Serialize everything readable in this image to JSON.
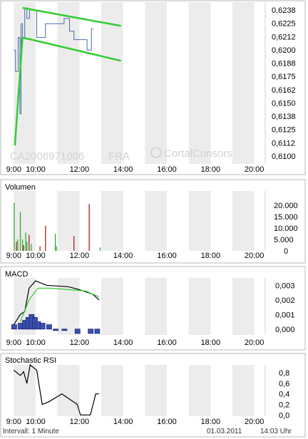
{
  "chart_data": [
    {
      "type": "line",
      "panel": "price",
      "isin_label": "CA2006971006",
      "exchange_label": "FRA",
      "watermark": "CortalConsors",
      "x_tick_labels": [
        "9:00",
        "10:00",
        "12:00",
        "14:00",
        "16:00",
        "18:00",
        "20:00"
      ],
      "y_tick_labels": [
        "0,6238",
        "0,6225",
        "0,6212",
        "0,6200",
        "0,6188",
        "0,6175",
        "0,6162",
        "0,6150",
        "0,6138",
        "0,6125",
        "0,6112",
        "0,6100"
      ],
      "ylim": [
        0.61,
        0.6238
      ],
      "series": [
        {
          "values_time_price": [
            [
              9.0,
              0.62
            ],
            [
              9.08,
              0.62
            ],
            [
              9.08,
              0.618
            ],
            [
              9.2,
              0.618
            ],
            [
              9.2,
              0.6212
            ],
            [
              9.28,
              0.6212
            ],
            [
              9.28,
              0.614
            ],
            [
              9.33,
              0.614
            ],
            [
              9.33,
              0.6225
            ],
            [
              9.4,
              0.6225
            ],
            [
              9.4,
              0.6212
            ],
            [
              9.5,
              0.6212
            ],
            [
              9.5,
              0.624
            ],
            [
              9.6,
              0.624
            ],
            [
              9.6,
              0.623
            ],
            [
              9.72,
              0.623
            ],
            [
              9.72,
              0.6238
            ],
            [
              10.05,
              0.6238
            ],
            [
              10.05,
              0.6212
            ],
            [
              10.45,
              0.6212
            ],
            [
              10.45,
              0.6225
            ],
            [
              11.3,
              0.6225
            ],
            [
              11.3,
              0.623
            ],
            [
              11.55,
              0.623
            ],
            [
              11.55,
              0.6218
            ],
            [
              11.75,
              0.6218
            ],
            [
              11.75,
              0.621
            ],
            [
              12.35,
              0.621
            ],
            [
              12.35,
              0.62
            ],
            [
              12.55,
              0.62
            ],
            [
              12.55,
              0.622
            ],
            [
              12.65,
              0.622
            ]
          ]
        }
      ],
      "trendlines": [
        {
          "from": [
            9.05,
            0.611
          ],
          "to": [
            9.4,
            0.6212
          ]
        },
        {
          "from": [
            9.4,
            0.624
          ],
          "to": [
            13.9,
            0.6223
          ]
        },
        {
          "from": [
            9.4,
            0.6212
          ],
          "to": [
            13.9,
            0.619
          ]
        }
      ],
      "colors": {
        "price_line": "#4a6fa5",
        "trendline": "#33cc33",
        "band": "#ececec"
      }
    },
    {
      "type": "bar",
      "panel": "volume",
      "title": "Volumen",
      "y_tick_labels": [
        "20.000",
        "15.000",
        "10.000",
        "5.000",
        "0"
      ],
      "ylim": [
        0,
        24000
      ],
      "bars_time_value_color": [
        [
          9.02,
          21000,
          "green"
        ],
        [
          9.12,
          4000,
          "red"
        ],
        [
          9.18,
          5000,
          "green"
        ],
        [
          9.3,
          17000,
          "green"
        ],
        [
          9.4,
          5000,
          "green"
        ],
        [
          9.45,
          2500,
          "red"
        ],
        [
          9.55,
          8000,
          "green"
        ],
        [
          9.6,
          4000,
          "green"
        ],
        [
          9.7,
          7000,
          "red"
        ],
        [
          9.8,
          3000,
          "green"
        ],
        [
          10.2,
          2000,
          "red"
        ],
        [
          10.45,
          11000,
          "red"
        ],
        [
          10.9,
          7500,
          "green"
        ],
        [
          10.95,
          2000,
          "green"
        ],
        [
          11.75,
          6500,
          "red"
        ],
        [
          12.45,
          20500,
          "red"
        ],
        [
          12.95,
          1500,
          "green"
        ]
      ],
      "colors": {
        "up": "#33aa33",
        "down": "#aa2222"
      }
    },
    {
      "type": "line",
      "panel": "macd",
      "title": "MACD",
      "y_tick_labels": [
        "0,003",
        "0,002",
        "0,001",
        "0,000"
      ],
      "ylim": [
        -0.0005,
        0.0035
      ],
      "series": [
        {
          "values_time": [
            [
              9.0,
              0.0003
            ],
            [
              9.3,
              0.001
            ],
            [
              9.5,
              0.0012
            ],
            [
              9.7,
              0.0028
            ],
            [
              10.0,
              0.0033
            ],
            [
              10.5,
              0.003
            ],
            [
              11.5,
              0.0029
            ],
            [
              12.0,
              0.0027
            ],
            [
              12.6,
              0.0024
            ],
            [
              12.9,
              0.002
            ]
          ],
          "color": "#000000"
        },
        {
          "values_time": [
            [
              9.3,
              0.0005
            ],
            [
              9.7,
              0.002
            ],
            [
              10.1,
              0.0028
            ],
            [
              10.7,
              0.0028
            ],
            [
              11.5,
              0.0027
            ],
            [
              12.3,
              0.0026
            ],
            [
              12.9,
              0.0022
            ]
          ],
          "color": "#33cc33"
        }
      ],
      "histogram_time_value": [
        [
          9.0,
          0.0003
        ],
        [
          9.3,
          0.0004
        ],
        [
          9.5,
          0.0006
        ],
        [
          9.65,
          0.0008
        ],
        [
          9.8,
          0.001
        ],
        [
          9.95,
          0.0008
        ],
        [
          10.1,
          0.0005
        ],
        [
          10.3,
          0.0004
        ],
        [
          10.6,
          0.0003
        ],
        [
          10.9,
          -0.0001
        ],
        [
          11.3,
          0.0
        ],
        [
          11.9,
          -0.0003
        ],
        [
          12.5,
          -0.0003
        ],
        [
          12.8,
          -0.0003
        ]
      ],
      "colors": {
        "hist_fill": "#3a4fb0",
        "hist_stroke": "#1c2770"
      }
    },
    {
      "type": "line",
      "panel": "stochastic_rsi",
      "title": "Stochastic RSI",
      "y_tick_labels": [
        "0,8",
        "0,6",
        "0,4",
        "0,2",
        "0,0"
      ],
      "ylim": [
        -0.05,
        0.95
      ],
      "series": [
        {
          "values_time": [
            [
              9.0,
              0.85
            ],
            [
              9.3,
              0.75
            ],
            [
              9.45,
              0.82
            ],
            [
              9.6,
              0.6
            ],
            [
              9.75,
              0.95
            ],
            [
              10.05,
              0.85
            ],
            [
              10.3,
              0.2
            ],
            [
              10.6,
              0.25
            ],
            [
              11.2,
              0.4
            ],
            [
              11.9,
              0.2
            ],
            [
              12.05,
              0.0
            ],
            [
              12.5,
              0.0
            ],
            [
              12.75,
              0.4
            ],
            [
              12.9,
              0.4
            ]
          ],
          "color": "#000000"
        }
      ]
    }
  ],
  "footer": {
    "interval_label": "Intervall: 1 Minute",
    "date_label": "01.03.2011",
    "time_label": "14:03 Uhr"
  }
}
